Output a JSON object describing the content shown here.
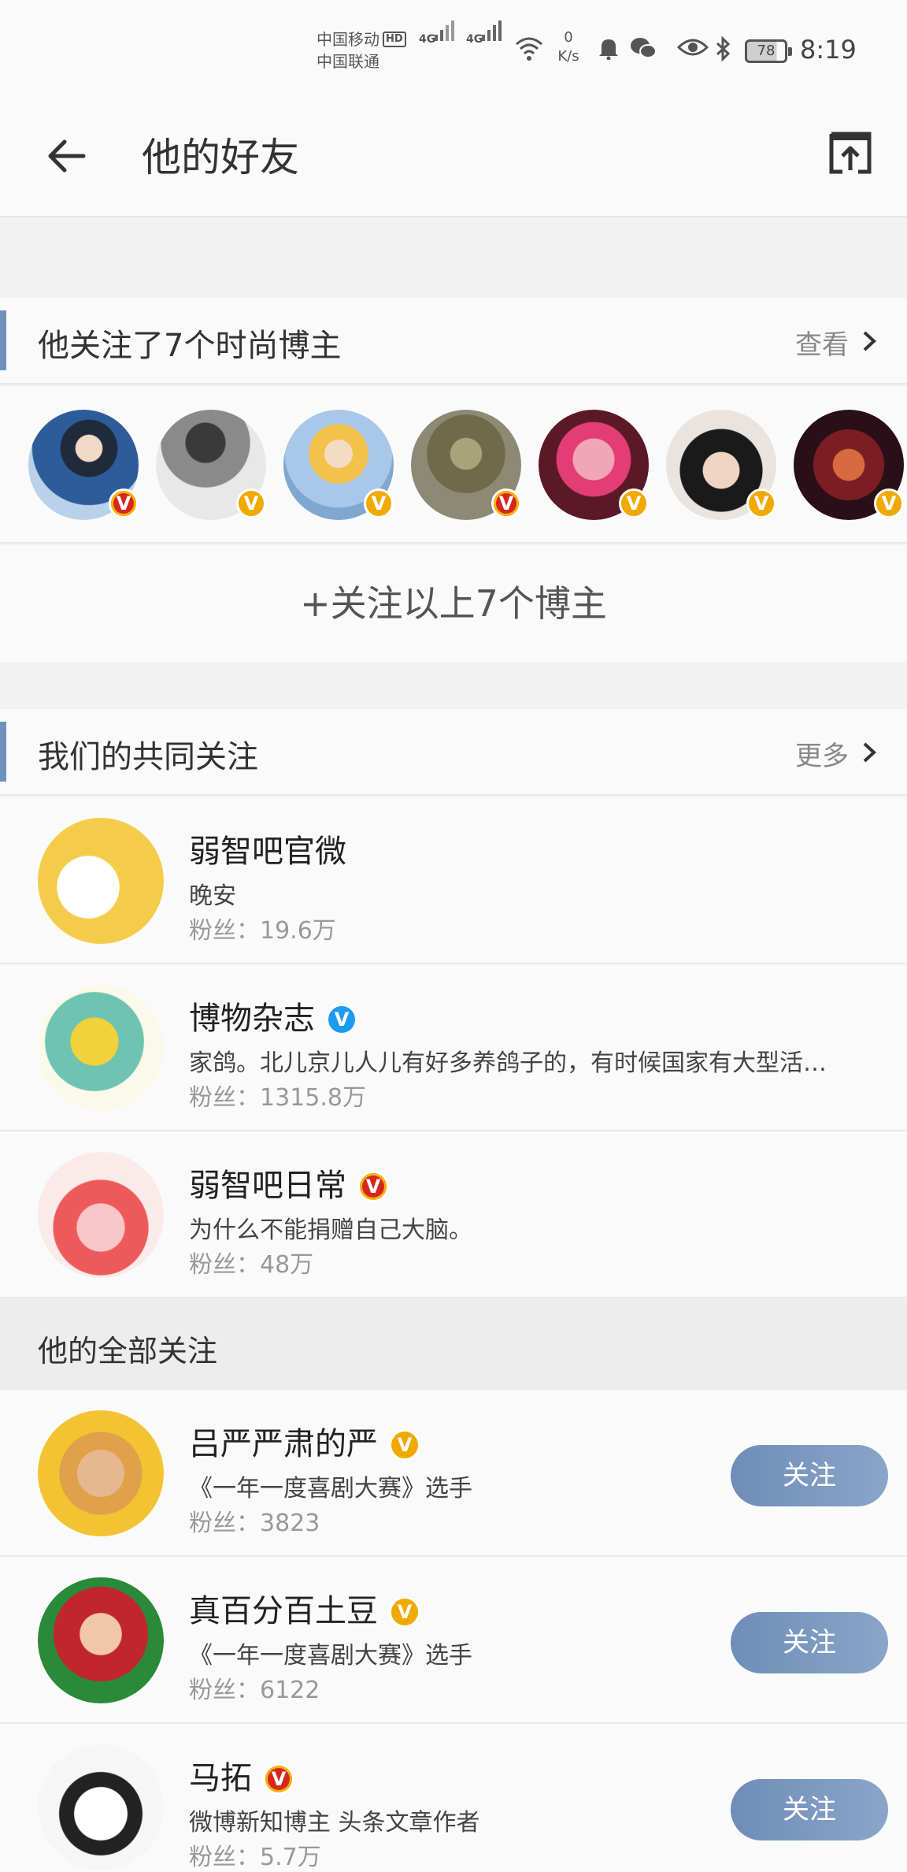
{
  "status_bar": {
    "carrier1": "中国移动",
    "carrier1_badge": "HD",
    "carrier2": "中国联通",
    "net1": "4G",
    "net2": "4G",
    "speed_value": "0",
    "speed_unit": "K/s",
    "battery": "78",
    "time": "8:19"
  },
  "header": {
    "title": "他的好友"
  },
  "section_fashion": {
    "title": "他关注了7个时尚博主",
    "more": "查看",
    "follow_all": "+关注以上7个博主",
    "avatars": [
      {
        "badge": "red"
      },
      {
        "badge": "orange"
      },
      {
        "badge": "orange"
      },
      {
        "badge": "red"
      },
      {
        "badge": "orange"
      },
      {
        "badge": "orange"
      },
      {
        "badge": "orange"
      }
    ]
  },
  "section_common": {
    "title": "我们的共同关注",
    "more": "更多",
    "users": [
      {
        "name": "弱智吧官微",
        "desc": "晚安",
        "fans": "粉丝：19.6万",
        "badge": ""
      },
      {
        "name": "博物杂志",
        "desc": "家鸽。北儿京儿人儿有好多养鸽子的，有时候国家有大型活…",
        "fans": "粉丝：1315.8万",
        "badge": "blue"
      },
      {
        "name": "弱智吧日常",
        "desc": "为什么不能捐赠自己大脑。",
        "fans": "粉丝：48万",
        "badge": "red"
      }
    ]
  },
  "section_all": {
    "title": "他的全部关注",
    "button_label": "关注",
    "users": [
      {
        "name": "吕严严肃的严",
        "desc": "《一年一度喜剧大赛》选手",
        "fans": "粉丝：3823",
        "badge": "orange"
      },
      {
        "name": "真百分百土豆",
        "desc": "《一年一度喜剧大赛》选手",
        "fans": "粉丝：6122",
        "badge": "orange"
      },
      {
        "name": "马拓",
        "desc": "微博新知博主 头条文章作者",
        "fans": "粉丝：5.7万",
        "badge": "red"
      }
    ]
  },
  "badge_letter": "V",
  "colors": {
    "accent": "#6f90b8",
    "badge_orange": "#f0a900",
    "badge_red": "#d7261c",
    "badge_blue": "#1d9bf0"
  }
}
